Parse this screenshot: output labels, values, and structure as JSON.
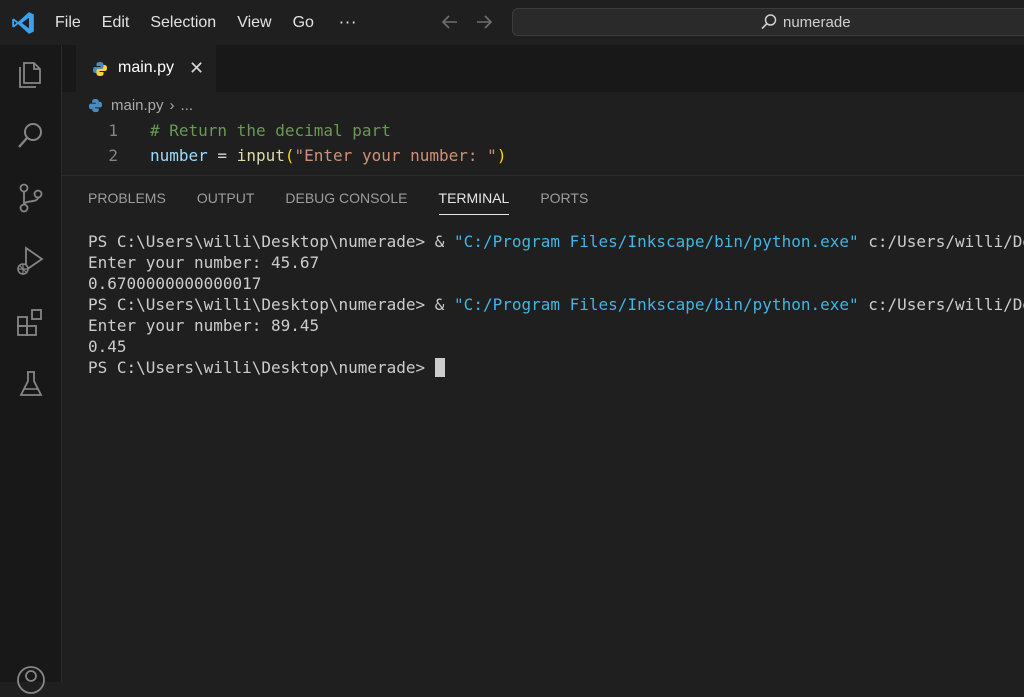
{
  "titlebar": {
    "menu": [
      "File",
      "Edit",
      "Selection",
      "View",
      "Go"
    ],
    "more": "···",
    "search_text": "numerade"
  },
  "tab": {
    "label": "main.py",
    "close": "✕"
  },
  "breadcrumb": {
    "file": "main.py",
    "sep": "›",
    "rest": "..."
  },
  "editor": {
    "lines": [
      {
        "number": "1",
        "comment": "# Return the decimal part"
      },
      {
        "number": "2",
        "var": "number",
        "op": " = ",
        "fn": "input",
        "paren_open": "(",
        "str": "\"Enter your number: \"",
        "paren_close": ")"
      }
    ]
  },
  "panel": {
    "tabs": [
      "PROBLEMS",
      "OUTPUT",
      "DEBUG CONSOLE",
      "TERMINAL",
      "PORTS"
    ],
    "active": "TERMINAL"
  },
  "terminal": {
    "lines": [
      {
        "prompt": "PS C:\\Users\\willi\\Desktop\\numerade> & ",
        "str": "\"C:/Program Files/Inkscape/bin/python.exe\"",
        "rest": " c:/Users/willi/Desktop/numerade/main.py"
      },
      {
        "text": "Enter your number: 45.67"
      },
      {
        "text": "0.6700000000000017"
      },
      {
        "prompt": "PS C:\\Users\\willi\\Desktop\\numerade> & ",
        "str": "\"C:/Program Files/Inkscape/bin/python.exe\"",
        "rest": " c:/Users/willi/Desktop/numerade/main.py"
      },
      {
        "text": "Enter your number: 89.45"
      },
      {
        "text": "0.45"
      },
      {
        "text": "PS C:\\Users\\willi\\Desktop\\numerade> "
      }
    ]
  },
  "colors": {
    "accent_blue": "#3fb6e6",
    "comment": "#6a9955",
    "string": "#ce9178",
    "function": "#dcdcaa",
    "variable": "#9cdcfe"
  }
}
